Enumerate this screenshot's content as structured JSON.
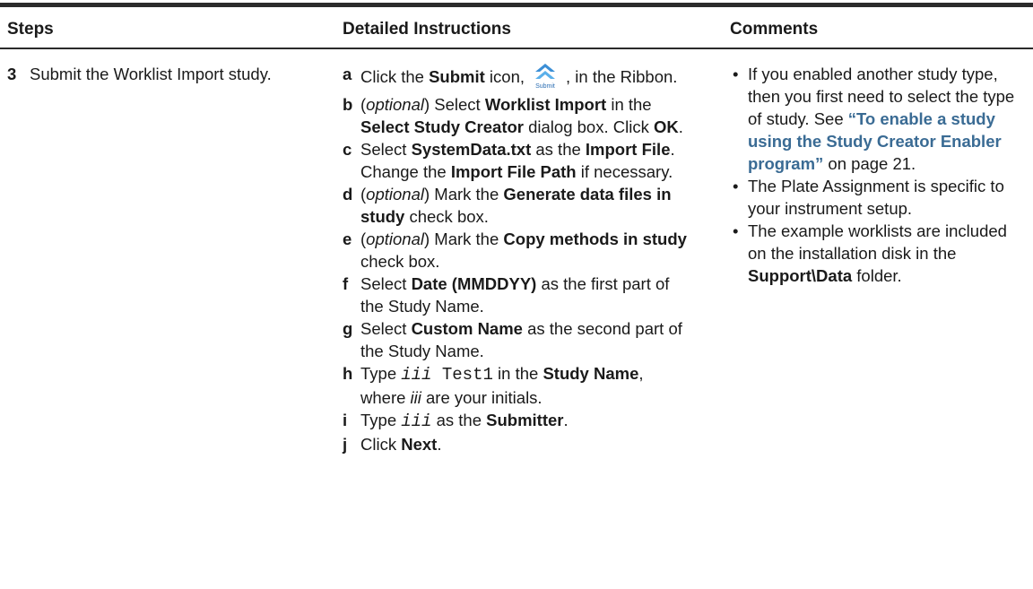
{
  "headers": {
    "steps": "Steps",
    "instructions": "Detailed Instructions",
    "comments": "Comments"
  },
  "step": {
    "number": "3",
    "text": "Submit the Worklist Import study."
  },
  "instructions": {
    "a": {
      "letter": "a",
      "t1": "Click the ",
      "b1": "Submit",
      "t2": " icon,",
      "t3": ", in the Ribbon.",
      "icon_name": "submit-icon",
      "icon_caption": "Submit"
    },
    "b": {
      "letter": "b",
      "p1": "(",
      "i1": "optional",
      "p2": ") Select ",
      "b1": "Worklist Import",
      "t1": " in the ",
      "b2": "Select Study Creator",
      "t2": " dialog box. Click ",
      "b3": "OK",
      "t3": "."
    },
    "c": {
      "letter": "c",
      "t1": "Select ",
      "b1": "SystemData.txt",
      "t2": " as the ",
      "b2": "Import File",
      "t3": ". Change the ",
      "b3": "Import File Path",
      "t4": " if necessary."
    },
    "d": {
      "letter": "d",
      "p1": "(",
      "i1": "optional",
      "p2": ") Mark the ",
      "b1": "Generate data files in study",
      "t1": " check box."
    },
    "e": {
      "letter": "e",
      "p1": "(",
      "i1": "optional",
      "p2": ") Mark the ",
      "b1": "Copy methods in study",
      "t1": " check box."
    },
    "f": {
      "letter": "f",
      "t1": "Select ",
      "b1": "Date (MMDDYY)",
      "t2": " as the first part of the Study Name."
    },
    "g": {
      "letter": "g",
      "t1": "Select ",
      "b1": "Custom Name",
      "t2": " as the second part of the Study Name."
    },
    "h": {
      "letter": "h",
      "t1": "Type ",
      "m1": "iii",
      "m2": " Test1",
      "t2": " in the ",
      "b1": "Study Name",
      "t3": ", where ",
      "i1": "iii",
      "t4": " are your initials."
    },
    "i": {
      "letter": "i",
      "t1": "Type ",
      "m1": "iii",
      "t2": " as the ",
      "b1": "Submitter",
      "t3": "."
    },
    "j": {
      "letter": "j",
      "t1": "Click ",
      "b1": "Next",
      "t2": "."
    }
  },
  "comments": {
    "bullet": "•",
    "c1": {
      "t1": "If you enabled another study type, then you first need to select the type of study. See ",
      "link": "“To enable a study using the Study Creator Enabler program”",
      "t2": " on page 21."
    },
    "c2": {
      "t1": "The Plate Assignment is specific to your instrument setup."
    },
    "c3": {
      "t1": "The example worklists are included on the installation disk in the ",
      "b1": "Support\\Data",
      "t2": " folder."
    }
  },
  "colors": {
    "link": "#3a6b94",
    "rule": "#2b2b2b",
    "icon_blue": "#2d6fb3"
  }
}
